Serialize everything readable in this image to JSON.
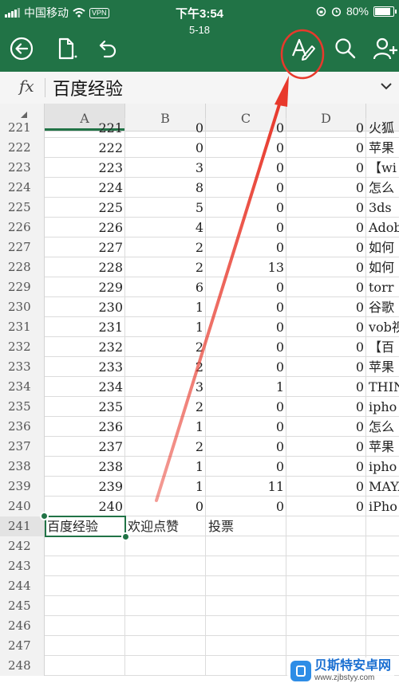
{
  "status": {
    "carrier": "中国移动",
    "vpn": "VPN",
    "time": "下午3:54",
    "battery": "80%"
  },
  "toolbar": {
    "subtitle": "5-18"
  },
  "formula_bar": {
    "fx_label": "fx",
    "value": "百度经验"
  },
  "columns": [
    "A",
    "B",
    "C",
    "D"
  ],
  "rows": [
    {
      "num": "221",
      "a": "221",
      "b": "0",
      "c": "0",
      "d": "0",
      "e": "火狐"
    },
    {
      "num": "222",
      "a": "222",
      "b": "0",
      "c": "0",
      "d": "0",
      "e": "苹果"
    },
    {
      "num": "223",
      "a": "223",
      "b": "3",
      "c": "0",
      "d": "0",
      "e": "【wi"
    },
    {
      "num": "224",
      "a": "224",
      "b": "8",
      "c": "0",
      "d": "0",
      "e": "怎么"
    },
    {
      "num": "225",
      "a": "225",
      "b": "5",
      "c": "0",
      "d": "0",
      "e": "3ds"
    },
    {
      "num": "226",
      "a": "226",
      "b": "4",
      "c": "0",
      "d": "0",
      "e": "Adob"
    },
    {
      "num": "227",
      "a": "227",
      "b": "2",
      "c": "0",
      "d": "0",
      "e": "如何"
    },
    {
      "num": "228",
      "a": "228",
      "b": "2",
      "c": "13",
      "d": "0",
      "e": "如何"
    },
    {
      "num": "229",
      "a": "229",
      "b": "6",
      "c": "0",
      "d": "0",
      "e": "torr"
    },
    {
      "num": "230",
      "a": "230",
      "b": "1",
      "c": "0",
      "d": "0",
      "e": "谷歌"
    },
    {
      "num": "231",
      "a": "231",
      "b": "1",
      "c": "0",
      "d": "0",
      "e": "vob视"
    },
    {
      "num": "232",
      "a": "232",
      "b": "2",
      "c": "0",
      "d": "0",
      "e": "【百"
    },
    {
      "num": "233",
      "a": "233",
      "b": "2",
      "c": "0",
      "d": "0",
      "e": "苹果"
    },
    {
      "num": "234",
      "a": "234",
      "b": "3",
      "c": "1",
      "d": "0",
      "e": "THIN"
    },
    {
      "num": "235",
      "a": "235",
      "b": "2",
      "c": "0",
      "d": "0",
      "e": "ipho"
    },
    {
      "num": "236",
      "a": "236",
      "b": "1",
      "c": "0",
      "d": "0",
      "e": "怎么"
    },
    {
      "num": "237",
      "a": "237",
      "b": "2",
      "c": "0",
      "d": "0",
      "e": "苹果"
    },
    {
      "num": "238",
      "a": "238",
      "b": "1",
      "c": "0",
      "d": "0",
      "e": "ipho"
    },
    {
      "num": "239",
      "a": "239",
      "b": "1",
      "c": "11",
      "d": "0",
      "e": "MAYA"
    },
    {
      "num": "240",
      "a": "240",
      "b": "0",
      "c": "0",
      "d": "0",
      "e": "iPho"
    },
    {
      "num": "241",
      "a": "百度经验",
      "b": "欢迎点赞",
      "c": "投票",
      "d": "",
      "e": "",
      "text": true,
      "selected": true
    },
    {
      "num": "242",
      "a": "",
      "b": "",
      "c": "",
      "d": "",
      "e": ""
    },
    {
      "num": "243",
      "a": "",
      "b": "",
      "c": "",
      "d": "",
      "e": ""
    },
    {
      "num": "244",
      "a": "",
      "b": "",
      "c": "",
      "d": "",
      "e": ""
    },
    {
      "num": "245",
      "a": "",
      "b": "",
      "c": "",
      "d": "",
      "e": ""
    },
    {
      "num": "246",
      "a": "",
      "b": "",
      "c": "",
      "d": "",
      "e": ""
    },
    {
      "num": "247",
      "a": "",
      "b": "",
      "c": "",
      "d": "",
      "e": ""
    },
    {
      "num": "248",
      "a": "",
      "b": "",
      "c": "",
      "d": "",
      "e": ""
    }
  ],
  "watermark": {
    "title": "贝斯特安卓网",
    "url": "www.zjbstyy.com"
  },
  "colors": {
    "accent": "#217346",
    "annotation": "#e8392c"
  }
}
